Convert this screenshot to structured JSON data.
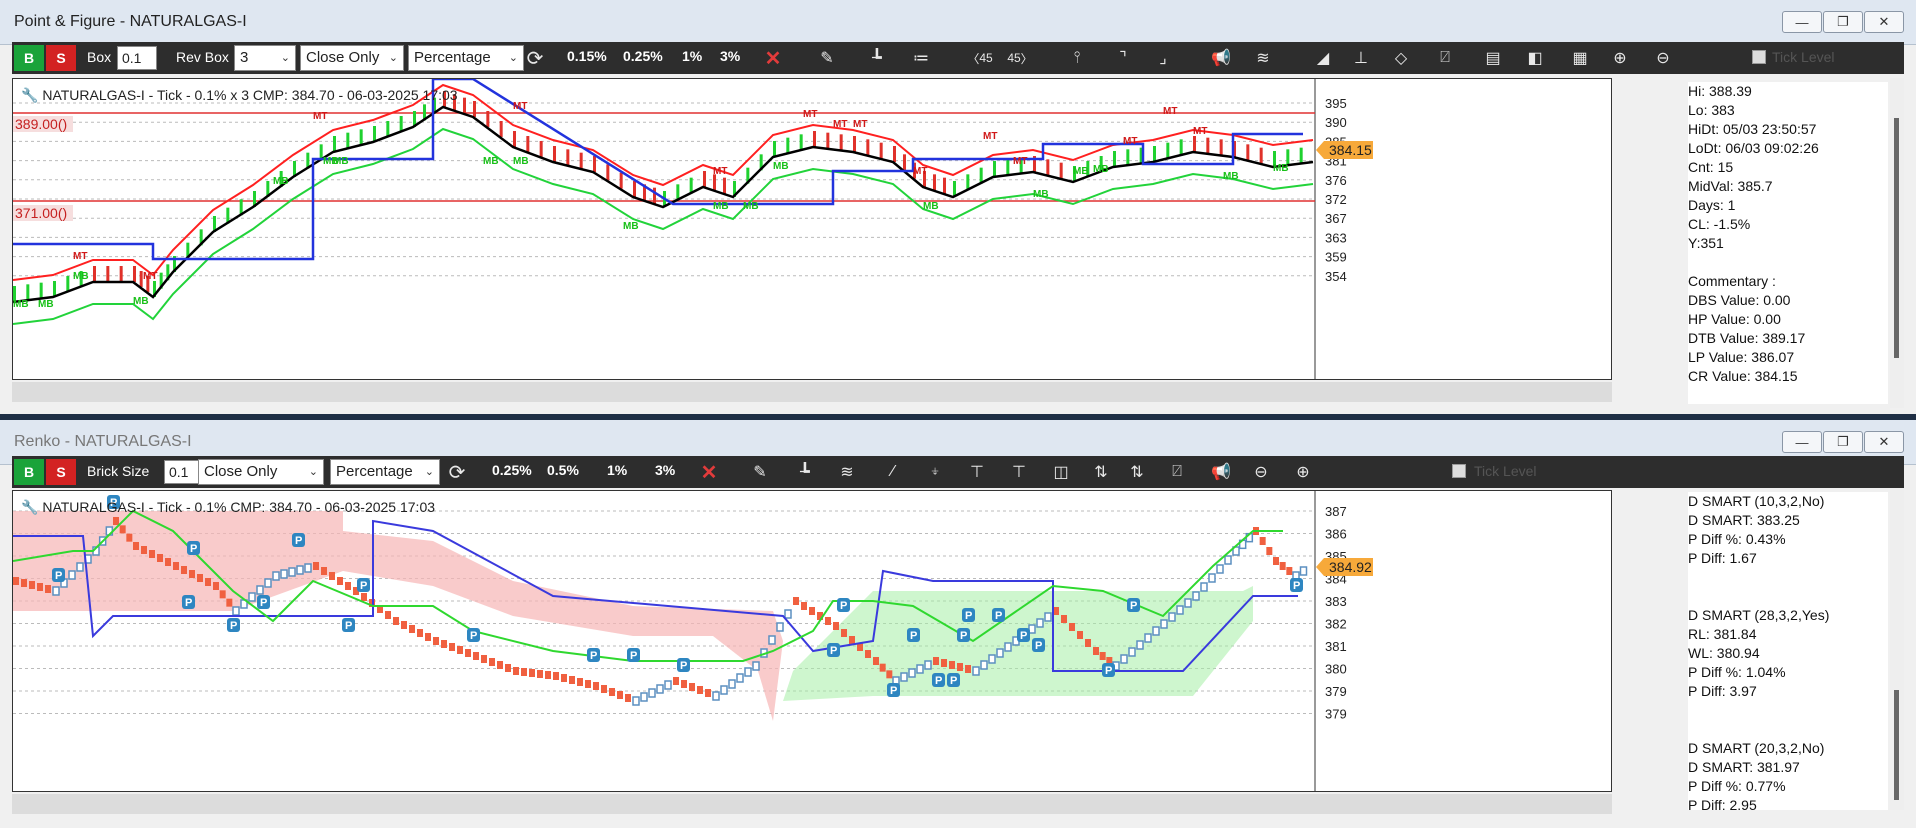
{
  "pf": {
    "title": "Point & Figure - NATURALGAS-I",
    "toolbar": {
      "b": "B",
      "s": "S",
      "box_label": "Box",
      "box_value": "0.1",
      "revbox_label": "Rev Box",
      "revbox_value": "3",
      "mode": "Close Only",
      "unit": "Percentage",
      "p1": "0.15%",
      "p2": "0.25%",
      "p3": "1%",
      "p4": "3%",
      "icon_45a": "45",
      "icon_45b": "45",
      "tick_level": "Tick Level"
    },
    "header": "NATURALGAS-I - Tick - 0.1% x 3 CMP: 384.70 - 06-03-2025 17:03",
    "level_high": "389.00()",
    "level_low": "371.00()",
    "price_tag": "384.15",
    "yaxis": [
      "395",
      "390",
      "385",
      "381",
      "376",
      "372",
      "367",
      "363",
      "359",
      "354"
    ],
    "info": [
      "Hi: 388.39",
      "Lo: 383",
      "HiDt: 05/03 23:50:57",
      "LoDt: 06/03 09:02:26",
      "Cnt: 15",
      "MidVal: 385.7",
      "Days: 1",
      "CL: -1.5%",
      "Y:351",
      "",
      "Commentary :",
      "DBS Value:  0.00",
      "HP Value: 0.00",
      "DTB Value: 389.17",
      "LP Value: 386.07",
      "CR Value: 384.15"
    ],
    "markers": {
      "mt": "MT",
      "mb": "MB"
    }
  },
  "renko": {
    "title": "Renko - NATURALGAS-I",
    "toolbar": {
      "b": "B",
      "s": "S",
      "brick_label": "Brick Size",
      "brick_value": "0.1",
      "mode": "Close Only",
      "unit": "Percentage",
      "p1": "0.25%",
      "p2": "0.5%",
      "p3": "1%",
      "p4": "3%",
      "tick_level": "Tick Level"
    },
    "header": "NATURALGAS-I - Tick - 0.1% CMP: 384.70 - 06-03-2025 17:03",
    "price_tag": "384.92",
    "yaxis": [
      "387",
      "386",
      "385",
      "384",
      "383",
      "382",
      "381",
      "380",
      "379",
      "379"
    ],
    "info": [
      "D SMART (10,3,2,No)",
      "D SMART: 383.25",
      "P Diff %: 0.43%",
      "P Diff: 1.67",
      "",
      "",
      "D SMART (28,3,2,Yes)",
      "RL: 381.84",
      "WL: 380.94",
      "P Diff %: 1.04%",
      "P Diff: 3.97",
      "",
      "",
      "D SMART (20,3,2,No)",
      "D SMART: 381.97",
      "P Diff %: 0.77%",
      "P Diff: 2.95"
    ],
    "markers": {
      "p": "P"
    }
  },
  "colors": {
    "up": "#1fd12f",
    "down": "#e0312a",
    "renko_up": "#5b8fc0",
    "renko_down": "#f06040",
    "accent": "#f7a93a"
  }
}
